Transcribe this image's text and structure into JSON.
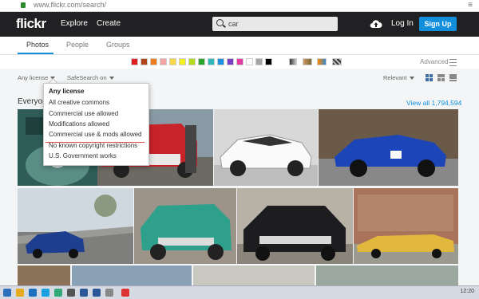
{
  "browser": {
    "url": "www.flickr.com/search/",
    "menu": "≡"
  },
  "nav": {
    "logo": "flickr",
    "explore": "Explore",
    "create": "Create",
    "search_value": "car",
    "login": "Log In",
    "signup": "Sign Up"
  },
  "tabs": [
    "Photos",
    "People",
    "Groups"
  ],
  "color_swatches": [
    "#e02020",
    "#b0441b",
    "#f27b1c",
    "#f5a3a3",
    "#f8d848",
    "#f3f020",
    "#b3dc1c",
    "#2aa52a",
    "#2fb6b6",
    "#1e90e0",
    "#7a3fc4",
    "#e23aa0",
    "#ffffff",
    "#a6a6a6",
    "#000000"
  ],
  "advanced": {
    "label": "Advanced"
  },
  "filters": {
    "license": "Any license",
    "safesearch": "SafeSearch on",
    "relevant": "Relevant"
  },
  "license_menu": [
    "Any license",
    "All creative commons",
    "Commercial use allowed",
    "Modifications allowed",
    "Commercial use & mods allowed",
    "No known copyright restrictions",
    "U.S. Government works"
  ],
  "heading": "Everyone",
  "view_all": "View all 1,794,594",
  "taskbar": {
    "time": "12:20"
  }
}
